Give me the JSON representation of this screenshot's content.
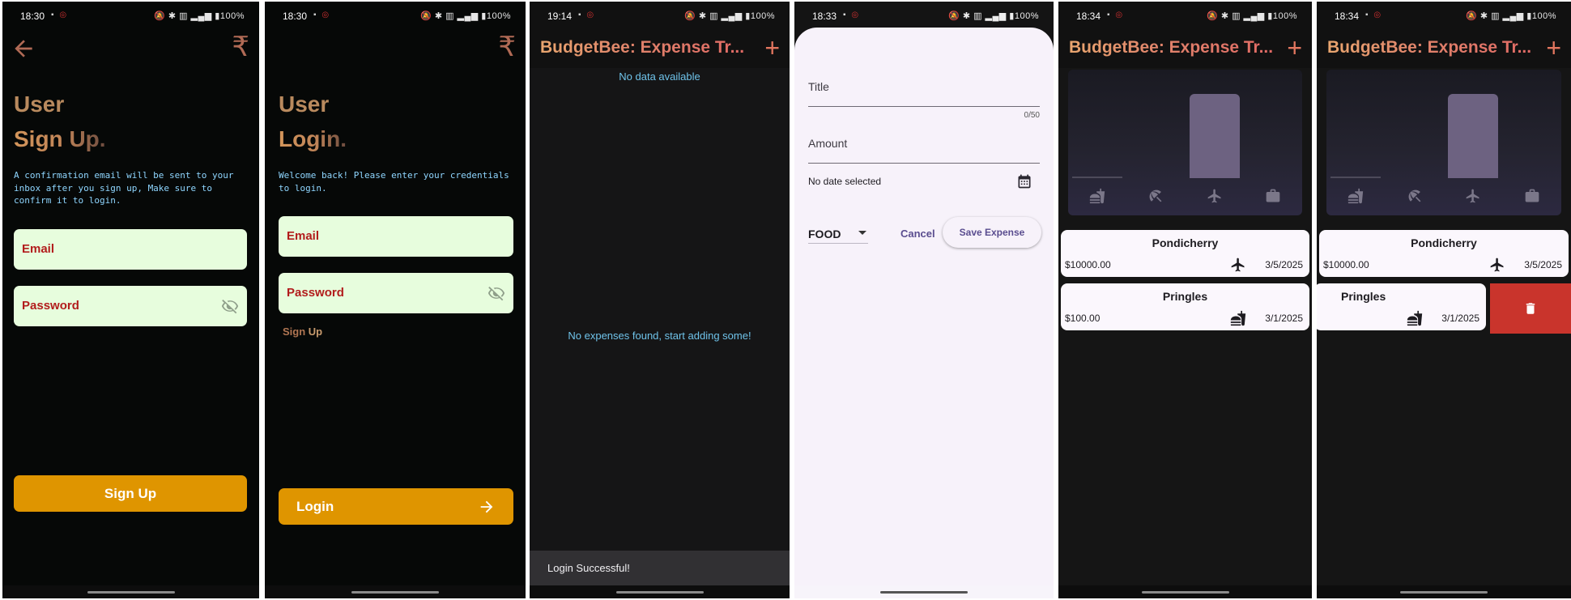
{
  "status": {
    "screen1_time": "18:30",
    "screen2_time": "18:30",
    "screen3_time": "19:14",
    "screen4_time": "18:33",
    "screen5_time": "18:34",
    "screen6_time": "18:34",
    "battery": "100%"
  },
  "colors": {
    "accent_orange": "#df9500",
    "field_bg": "#e7fddd",
    "field_label": "#b21c1c",
    "info_blue": "#6fc3ea",
    "delete_red": "#c9342c",
    "chart_bar": "#6d6281"
  },
  "signup": {
    "title_line1": "User",
    "title_line2": "Sign Up.",
    "info": "A confirmation email will be sent to your inbox after you sign up, Make sure to confirm it to login.",
    "email_label": "Email",
    "password_label": "Password",
    "button": "Sign Up",
    "icons": [
      "back-arrow-icon",
      "rupee-icon",
      "eye-off-icon"
    ]
  },
  "login": {
    "title_line1": "User",
    "title_line2": "Login.",
    "info": "Welcome back! Please enter your credentials to login.",
    "email_label": "Email",
    "password_label": "Password",
    "signup_link_a": "Sign ",
    "signup_link_b": "Up",
    "button": "Login",
    "icons": [
      "rupee-icon",
      "eye-off-icon",
      "arrow-forward-icon"
    ]
  },
  "app": {
    "title": "BudgetBee: Expense Tr...",
    "add_icon": "+"
  },
  "empty_home": {
    "chart_message": "No data available",
    "list_message": "No expenses found, start adding some!",
    "snackbar": "Login Successful!"
  },
  "add_expense": {
    "title_label": "Title",
    "title_counter": "0/50",
    "amount_label": "Amount",
    "date_text": "No date selected",
    "category": "FOOD",
    "cancel": "Cancel",
    "save": "Save Expense"
  },
  "chart_data": {
    "type": "bar",
    "categories": [
      "food",
      "leisure",
      "travel",
      "work"
    ],
    "category_icons": [
      "fastfood-icon",
      "beach-icon",
      "flight-icon",
      "work-icon"
    ],
    "values": [
      100,
      0,
      10000,
      0
    ]
  },
  "expenses": [
    {
      "title": "Pondicherry",
      "amount": "$10000.00",
      "date": "3/5/2025",
      "icon": "flight-icon"
    },
    {
      "title": "Pringles",
      "amount": "$100.00",
      "date": "3/1/2025",
      "icon": "fastfood-icon"
    }
  ],
  "swipe": {
    "icon": "delete-icon"
  }
}
